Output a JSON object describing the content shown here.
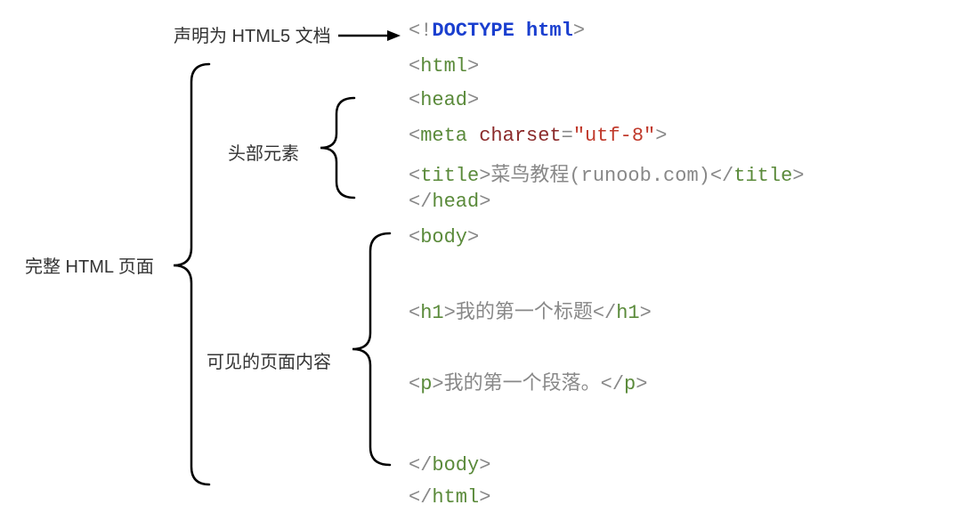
{
  "labels": {
    "doctype_decl": "声明为 HTML5 文档",
    "full_page": "完整 HTML 页面",
    "head_section": "头部元素",
    "body_section": "可见的页面内容"
  },
  "code": {
    "line1": {
      "bang": "!",
      "kw": "DOCTYPE html"
    },
    "line2": {
      "tag": "html"
    },
    "line3": {
      "tag": "head"
    },
    "line4": {
      "tag": "meta",
      "attr": "charset",
      "val": "\"utf-8\""
    },
    "line5": {
      "tag_open": "title",
      "text": "菜鸟教程(runoob.com)",
      "tag_close": "title"
    },
    "line6": {
      "tag": "head"
    },
    "line7": {
      "tag": "body"
    },
    "line8": {
      "tag_open": "h1",
      "text": "我的第一个标题",
      "tag_close": "h1"
    },
    "line9": {
      "tag_open": "p",
      "text": "我的第一个段落。",
      "tag_close": "p"
    },
    "line10": {
      "tag": "body"
    },
    "line11": {
      "tag": "html"
    }
  }
}
